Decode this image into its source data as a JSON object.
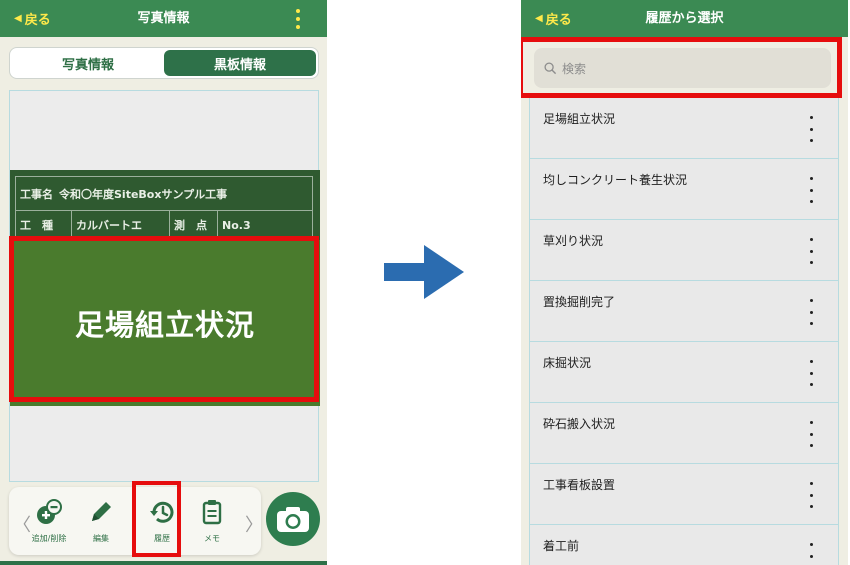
{
  "left_screen": {
    "header": {
      "back_label": "戻る",
      "title": "写真情報",
      "menu_icon": "kebab-icon"
    },
    "tabs": [
      {
        "label": "写真情報",
        "active": false
      },
      {
        "label": "黒板情報",
        "active": true
      }
    ],
    "blackboard": {
      "row1_label": "工事名",
      "row1_value": "令和〇年度SiteBoxサンプル工事",
      "row2_label": "工　種",
      "row2_value": "カルバートエ",
      "row2_label2": "測　点",
      "row2_value2": "No.3",
      "main_text": "足場組立状況"
    },
    "toolbar": {
      "items": [
        {
          "label": "追加/削除",
          "icon": "add-remove-icon"
        },
        {
          "label": "編集",
          "icon": "pencil-icon"
        },
        {
          "label": "履歴",
          "icon": "history-icon"
        },
        {
          "label": "メモ",
          "icon": "memo-icon"
        }
      ],
      "camera_icon": "camera-icon"
    }
  },
  "right_screen": {
    "header": {
      "back_label": "戻る",
      "title": "履歴から選択"
    },
    "search": {
      "placeholder": "検索"
    },
    "history_items": [
      "足場組立状況",
      "均しコンクリート養生状況",
      "草刈り状況",
      "置換掘削完了",
      "床掘状況",
      "砕石搬入状況",
      "工事看板設置",
      "着工前"
    ]
  },
  "colors": {
    "header_green": "#3b8a53",
    "accent_yellow": "#ffe94a",
    "highlight_red": "#e60d0d",
    "blackboard_green": "#4a7b2d",
    "arrow_blue": "#2b6cb0"
  }
}
